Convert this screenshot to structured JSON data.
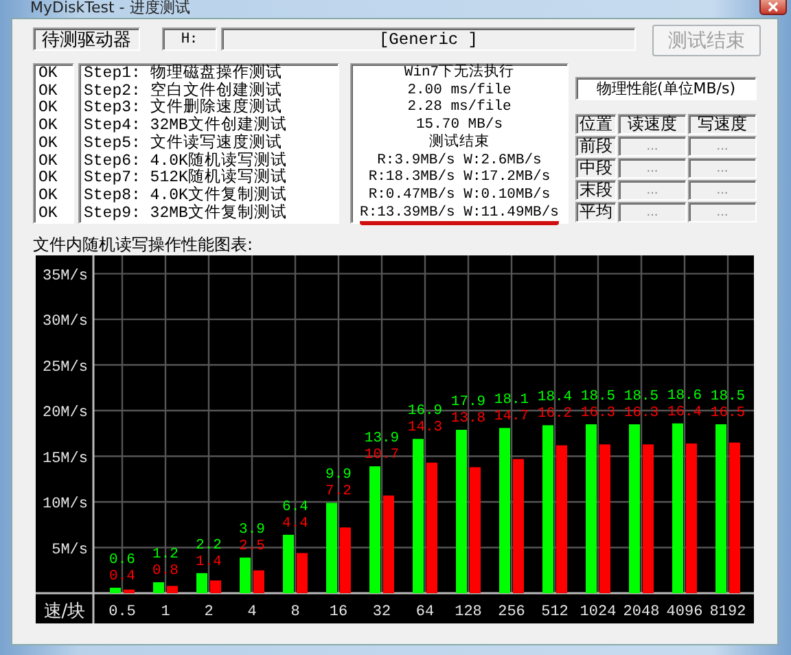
{
  "window": {
    "title": "MyDiskTest - 进度测试"
  },
  "drive": {
    "label": "待测驱动器",
    "letter": "H:",
    "name": "[Generic ]"
  },
  "stop_button": {
    "label": "测试结束",
    "disabled": true
  },
  "steps": [
    {
      "status": "OK",
      "label": "Step1: 物理磁盘操作测试"
    },
    {
      "status": "OK",
      "label": "Step2: 空白文件创建测试"
    },
    {
      "status": "OK",
      "label": "Step3: 文件删除速度测试"
    },
    {
      "status": "OK",
      "label": "Step4: 32MB文件创建测试"
    },
    {
      "status": "OK",
      "label": "Step5: 文件读写速度测试"
    },
    {
      "status": "OK",
      "label": "Step6: 4.0K随机读写测试"
    },
    {
      "status": "OK",
      "label": "Step7: 512K随机读写测试"
    },
    {
      "status": "OK",
      "label": "Step8: 4.0K文件复制测试"
    },
    {
      "status": "OK",
      "label": "Step9: 32MB文件复制测试"
    }
  ],
  "results": [
    {
      "text": "Win7下无法执行",
      "underlined": false
    },
    {
      "text": "2.00 ms/file",
      "underlined": false
    },
    {
      "text": "2.28 ms/file",
      "underlined": false
    },
    {
      "text": "15.70 MB/s",
      "underlined": false
    },
    {
      "text": "测试结束",
      "underlined": false
    },
    {
      "text": "R:3.9MB/s W:2.6MB/s",
      "underlined": false
    },
    {
      "text": "R:18.3MB/s W:17.2MB/s",
      "underlined": false
    },
    {
      "text": "R:0.47MB/s W:0.10MB/s",
      "underlined": false
    },
    {
      "text": "R:13.39MB/s W:11.49MB/s",
      "underlined": true
    }
  ],
  "physical": {
    "title": "物理性能(单位MB/s)",
    "columns": [
      "位置",
      "读速度",
      "写速度"
    ],
    "rows": [
      [
        "前段",
        "...",
        "..."
      ],
      [
        "中段",
        "...",
        "..."
      ],
      [
        "末段",
        "...",
        "..."
      ],
      [
        "平均",
        "...",
        "..."
      ]
    ]
  },
  "chart": {
    "title": "文件内随机读写操作性能图表:",
    "chart_data": {
      "type": "bar",
      "xlabel": "速/块",
      "categories": [
        "0.5",
        "1",
        "2",
        "4",
        "8",
        "16",
        "32",
        "64",
        "128",
        "256",
        "512",
        "1024",
        "2048",
        "4096",
        "8192"
      ],
      "series": [
        {
          "color": "#00ff00",
          "values": [
            0.6,
            1.2,
            2.2,
            3.9,
            6.4,
            9.9,
            13.9,
            16.9,
            17.9,
            18.1,
            18.4,
            18.5,
            18.5,
            18.6,
            18.5
          ]
        },
        {
          "color": "#ff0000",
          "values": [
            0.4,
            0.8,
            1.4,
            2.5,
            4.4,
            7.2,
            10.7,
            14.3,
            13.8,
            14.7,
            16.2,
            16.3,
            16.3,
            16.4,
            16.5
          ]
        }
      ],
      "ylim": [
        0,
        37
      ],
      "yticks": [
        {
          "value": 5,
          "label": "5M/s"
        },
        {
          "value": 10,
          "label": "10M/s"
        },
        {
          "value": 15,
          "label": "15M/s"
        },
        {
          "value": 20,
          "label": "20M/s"
        },
        {
          "value": 25,
          "label": "25M/s"
        },
        {
          "value": 30,
          "label": "30M/s"
        },
        {
          "value": 35,
          "label": "35M/s"
        }
      ],
      "data_labels": true,
      "grid": true
    }
  }
}
